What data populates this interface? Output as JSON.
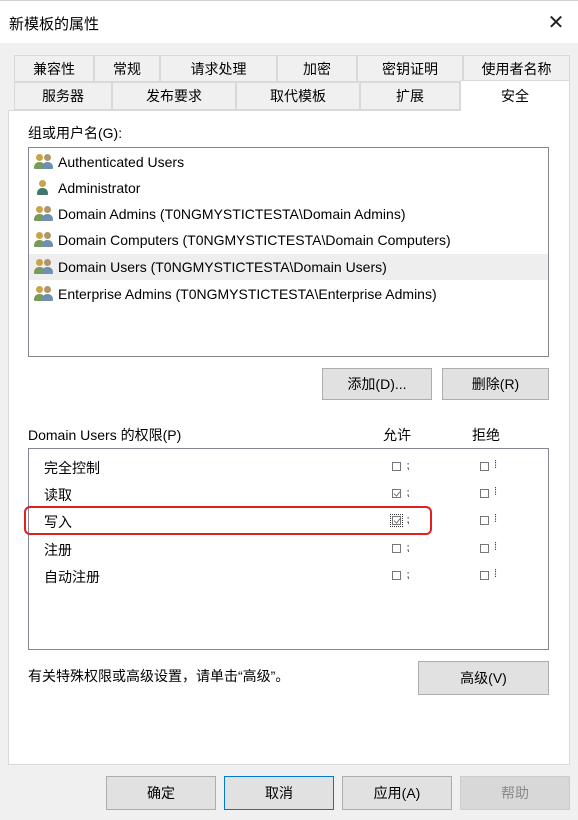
{
  "window": {
    "title": "新模板的属性",
    "close_glyph": "✕"
  },
  "tabs_row1": [
    "兼容性",
    "常规",
    "请求处理",
    "加密",
    "密钥证明",
    "使用者名称"
  ],
  "tabs_row2": [
    "服务器",
    "发布要求",
    "取代模板",
    "扩展",
    "安全"
  ],
  "active_tab": "安全",
  "group_label": "组或用户名(G):",
  "users": [
    {
      "name": "Authenticated Users",
      "icon": "user-group-icon"
    },
    {
      "name": "Administrator",
      "icon": "user-icon"
    },
    {
      "name": "Domain Admins (T0NGMYSTICTESTA\\Domain Admins)",
      "icon": "user-group-icon"
    },
    {
      "name": "Domain Computers (T0NGMYSTICTESTA\\Domain Computers)",
      "icon": "user-group-icon"
    },
    {
      "name": "Domain Users (T0NGMYSTICTESTA\\Domain Users)",
      "icon": "user-group-icon",
      "selected": true
    },
    {
      "name": "Enterprise Admins (T0NGMYSTICTESTA\\Enterprise Admins)",
      "icon": "user-group-icon"
    }
  ],
  "buttons": {
    "add": "添加(D)...",
    "remove": "删除(R)",
    "advanced": "高级(V)"
  },
  "permissions_label": "Domain Users 的权限(P)",
  "allow_header": "允许",
  "deny_header": "拒绝",
  "permissions": [
    {
      "name": "完全控制",
      "allow": false,
      "deny": false
    },
    {
      "name": "读取",
      "allow": true,
      "deny": false
    },
    {
      "name": "写入",
      "allow": true,
      "deny": false
    },
    {
      "name": "注册",
      "allow": false,
      "deny": false
    },
    {
      "name": "自动注册",
      "allow": false,
      "deny": false
    }
  ],
  "advanced_note": "有关特殊权限或高级设置，请单击“高级”。",
  "footer": {
    "ok": "确定",
    "cancel": "取消",
    "apply": "应用(A)",
    "help": "帮助"
  },
  "colors": {
    "highlight": "#e02020",
    "selection": "#eeeeee",
    "focus_border": "#0078d7"
  }
}
